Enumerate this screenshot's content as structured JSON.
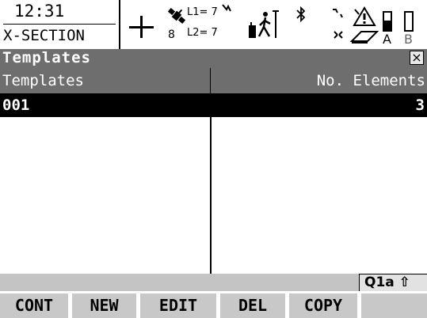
{
  "status": {
    "time": "12:31",
    "app_name": "X-SECTION",
    "satellites": "8",
    "l1": "L1= 7",
    "l2": "L2= 7",
    "battery_a_label": "A",
    "battery_b_label": "B",
    "battery_a_level": 0.55,
    "icons": [
      "crosshair-icon",
      "satellite-icon",
      "antenna-icon",
      "bluetooth-icon",
      "radio-icon",
      "warning-icon",
      "memory-card-icon",
      "battery-icon"
    ]
  },
  "title": "Templates",
  "close_label": "×",
  "table": {
    "headers": [
      "Templates",
      "No. Elements"
    ],
    "rows": [
      {
        "template": "001",
        "elements": "3"
      }
    ]
  },
  "keyboard_status": "Q1a ⇧",
  "softkeys": [
    "CONT",
    "NEW",
    "EDIT",
    "DEL",
    "COPY",
    ""
  ]
}
